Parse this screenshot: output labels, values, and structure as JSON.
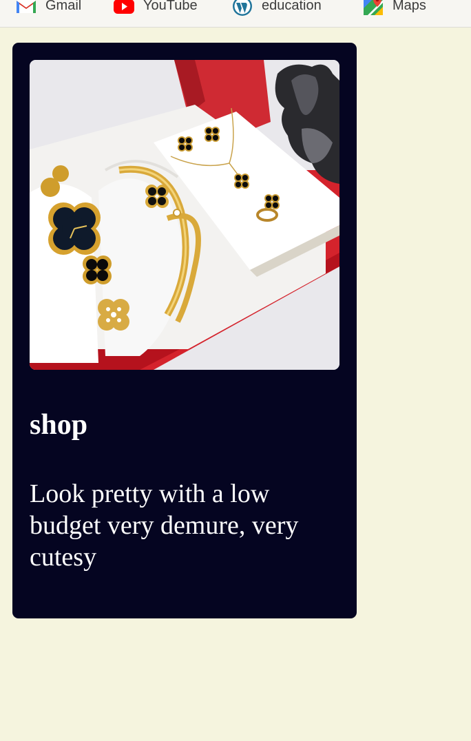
{
  "bookmarks": [
    {
      "label": "Gmail",
      "icon": "gmail-icon"
    },
    {
      "label": "YouTube",
      "icon": "youtube-icon"
    },
    {
      "label": "education",
      "icon": "wordpress-icon"
    },
    {
      "label": "Maps",
      "icon": "maps-icon"
    }
  ],
  "card": {
    "image_icon": "jewelry-gift-set-image",
    "title": "shop",
    "text": "Look pretty with a low budget very demure, very cutesy"
  },
  "colors": {
    "page_background": "#f5f4de",
    "card_background": "#050521",
    "card_text": "#ffffff"
  }
}
